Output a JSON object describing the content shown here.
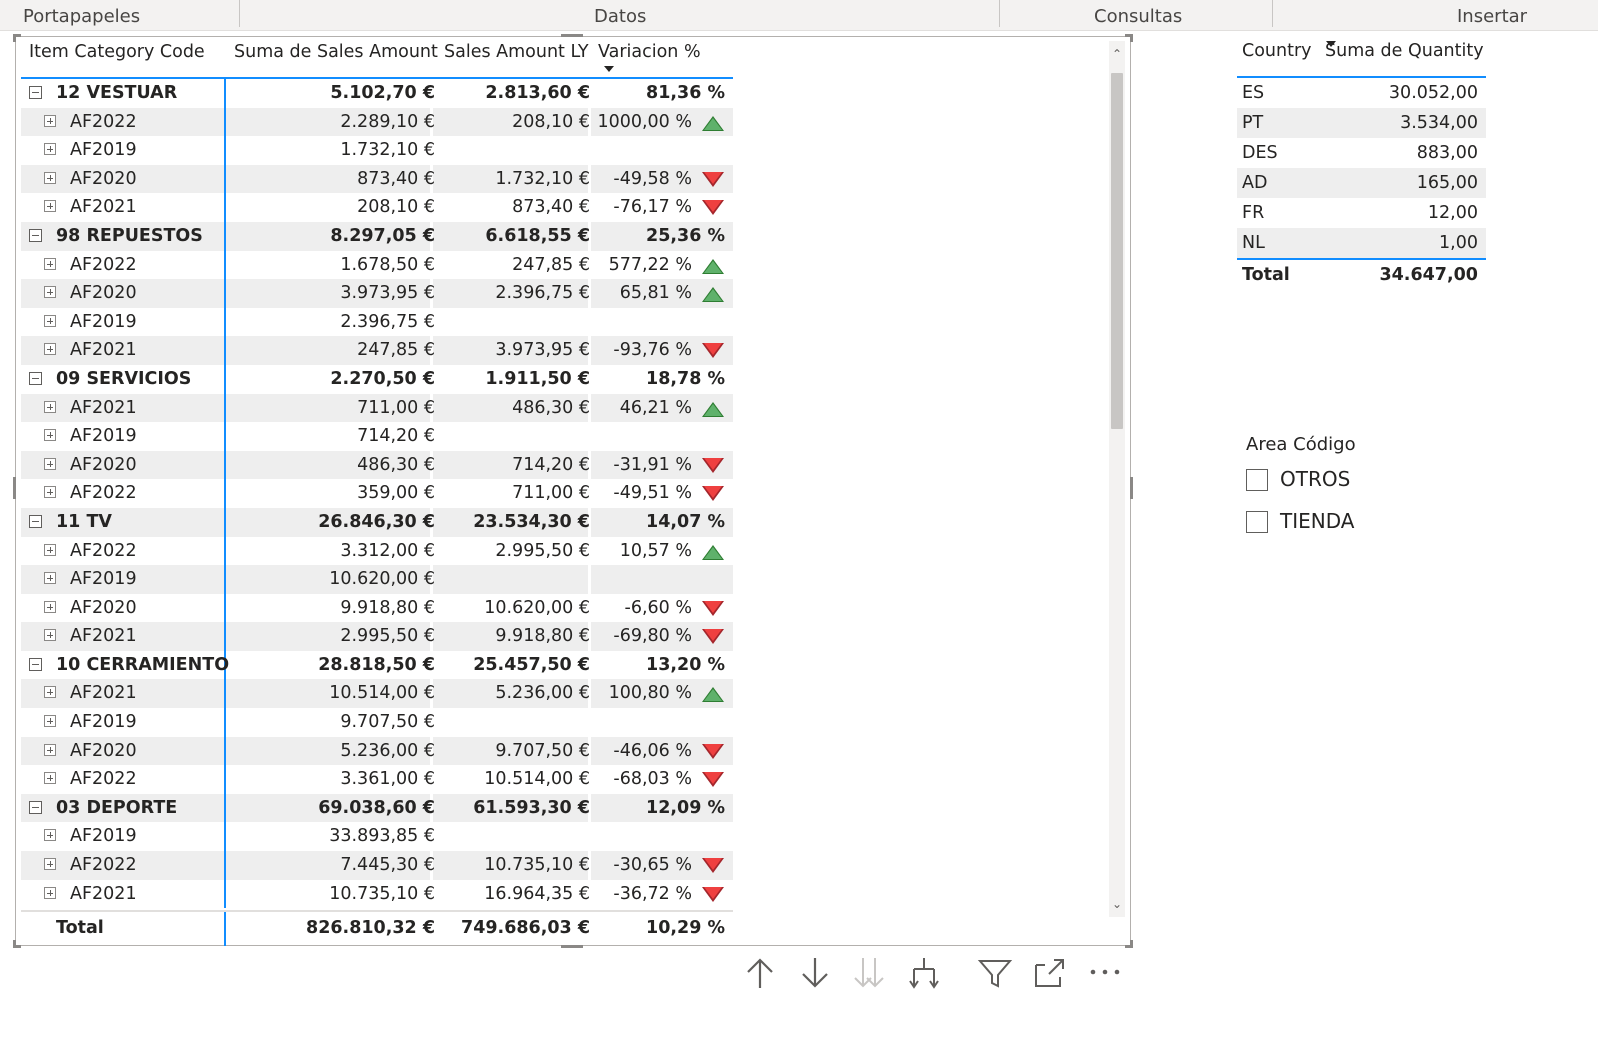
{
  "ribbon": {
    "groups": [
      "Portapapeles",
      "Datos",
      "Consultas",
      "Insertar"
    ]
  },
  "matrix": {
    "headers": [
      "Item Category Code",
      "Suma de Sales Amount",
      "Sales Amount LY",
      "Variacion %"
    ],
    "rows": [
      {
        "type": "cat",
        "label": "12 VESTUAR",
        "sales": "5.102,70 €",
        "ly": "2.813,60 €",
        "var": "81,36 %",
        "trend": ""
      },
      {
        "type": "sub",
        "label": "AF2022",
        "sales": "2.289,10 €",
        "ly": "208,10 €",
        "var": "1000,00 %",
        "trend": "up"
      },
      {
        "type": "sub",
        "label": "AF2019",
        "sales": "1.732,10 €",
        "ly": "",
        "var": "",
        "trend": ""
      },
      {
        "type": "sub",
        "label": "AF2020",
        "sales": "873,40 €",
        "ly": "1.732,10 €",
        "var": "-49,58 %",
        "trend": "down"
      },
      {
        "type": "sub",
        "label": "AF2021",
        "sales": "208,10 €",
        "ly": "873,40 €",
        "var": "-76,17 %",
        "trend": "down"
      },
      {
        "type": "cat",
        "label": "98 REPUESTOS",
        "sales": "8.297,05 €",
        "ly": "6.618,55 €",
        "var": "25,36 %",
        "trend": ""
      },
      {
        "type": "sub",
        "label": "AF2022",
        "sales": "1.678,50 €",
        "ly": "247,85 €",
        "var": "577,22 %",
        "trend": "up"
      },
      {
        "type": "sub",
        "label": "AF2020",
        "sales": "3.973,95 €",
        "ly": "2.396,75 €",
        "var": "65,81 %",
        "trend": "up"
      },
      {
        "type": "sub",
        "label": "AF2019",
        "sales": "2.396,75 €",
        "ly": "",
        "var": "",
        "trend": ""
      },
      {
        "type": "sub",
        "label": "AF2021",
        "sales": "247,85 €",
        "ly": "3.973,95 €",
        "var": "-93,76 %",
        "trend": "down"
      },
      {
        "type": "cat",
        "label": "09 SERVICIOS",
        "sales": "2.270,50 €",
        "ly": "1.911,50 €",
        "var": "18,78 %",
        "trend": ""
      },
      {
        "type": "sub",
        "label": "AF2021",
        "sales": "711,00 €",
        "ly": "486,30 €",
        "var": "46,21 %",
        "trend": "up"
      },
      {
        "type": "sub",
        "label": "AF2019",
        "sales": "714,20 €",
        "ly": "",
        "var": "",
        "trend": ""
      },
      {
        "type": "sub",
        "label": "AF2020",
        "sales": "486,30 €",
        "ly": "714,20 €",
        "var": "-31,91 %",
        "trend": "down"
      },
      {
        "type": "sub",
        "label": "AF2022",
        "sales": "359,00 €",
        "ly": "711,00 €",
        "var": "-49,51 %",
        "trend": "down"
      },
      {
        "type": "cat",
        "label": "11 TV",
        "sales": "26.846,30 €",
        "ly": "23.534,30 €",
        "var": "14,07 %",
        "trend": ""
      },
      {
        "type": "sub",
        "label": "AF2022",
        "sales": "3.312,00 €",
        "ly": "2.995,50 €",
        "var": "10,57 %",
        "trend": "up"
      },
      {
        "type": "sub",
        "label": "AF2019",
        "sales": "10.620,00 €",
        "ly": "",
        "var": "",
        "trend": ""
      },
      {
        "type": "sub",
        "label": "AF2020",
        "sales": "9.918,80 €",
        "ly": "10.620,00 €",
        "var": "-6,60 %",
        "trend": "down"
      },
      {
        "type": "sub",
        "label": "AF2021",
        "sales": "2.995,50 €",
        "ly": "9.918,80 €",
        "var": "-69,80 %",
        "trend": "down"
      },
      {
        "type": "cat",
        "label": "10 CERRAMIENTO",
        "sales": "28.818,50 €",
        "ly": "25.457,50 €",
        "var": "13,20 %",
        "trend": ""
      },
      {
        "type": "sub",
        "label": "AF2021",
        "sales": "10.514,00 €",
        "ly": "5.236,00 €",
        "var": "100,80 %",
        "trend": "up"
      },
      {
        "type": "sub",
        "label": "AF2019",
        "sales": "9.707,50 €",
        "ly": "",
        "var": "",
        "trend": ""
      },
      {
        "type": "sub",
        "label": "AF2020",
        "sales": "5.236,00 €",
        "ly": "9.707,50 €",
        "var": "-46,06 %",
        "trend": "down"
      },
      {
        "type": "sub",
        "label": "AF2022",
        "sales": "3.361,00 €",
        "ly": "10.514,00 €",
        "var": "-68,03 %",
        "trend": "down"
      },
      {
        "type": "cat",
        "label": "03 DEPORTE",
        "sales": "69.038,60 €",
        "ly": "61.593,30 €",
        "var": "12,09 %",
        "trend": ""
      },
      {
        "type": "sub",
        "label": "AF2019",
        "sales": "33.893,85 €",
        "ly": "",
        "var": "",
        "trend": ""
      },
      {
        "type": "sub",
        "label": "AF2022",
        "sales": "7.445,30 €",
        "ly": "10.735,10 €",
        "var": "-30,65 %",
        "trend": "down"
      },
      {
        "type": "sub",
        "label": "AF2021",
        "sales": "10.735,10 €",
        "ly": "16.964,35 €",
        "var": "-36,72 %",
        "trend": "down"
      }
    ],
    "total": {
      "label": "Total",
      "sales": "826.810,32 €",
      "ly": "749.686,03 €",
      "var": "10,29 %"
    }
  },
  "toolbar": {
    "icons": [
      "drill-up-icon",
      "drill-down-icon",
      "go-to-next-level-icon",
      "expand-next-level-icon",
      "filter-icon",
      "focus-mode-icon",
      "more-options-icon"
    ]
  },
  "country_table": {
    "headers": [
      "Country",
      "Suma de Quantity"
    ],
    "rows": [
      {
        "country": "ES",
        "qty": "30.052,00"
      },
      {
        "country": "PT",
        "qty": "3.534,00"
      },
      {
        "country": "DES",
        "qty": "883,00"
      },
      {
        "country": "AD",
        "qty": "165,00"
      },
      {
        "country": "FR",
        "qty": "12,00"
      },
      {
        "country": "NL",
        "qty": "1,00"
      }
    ],
    "total": {
      "label": "Total",
      "qty": "34.647,00"
    }
  },
  "slicer": {
    "title": "Area Código",
    "options": [
      "OTROS",
      "TIENDA"
    ]
  },
  "colors": {
    "accent": "#118dff",
    "up": "#5fb16b",
    "down": "#ef4040",
    "alt_row": "#eeeeee"
  }
}
